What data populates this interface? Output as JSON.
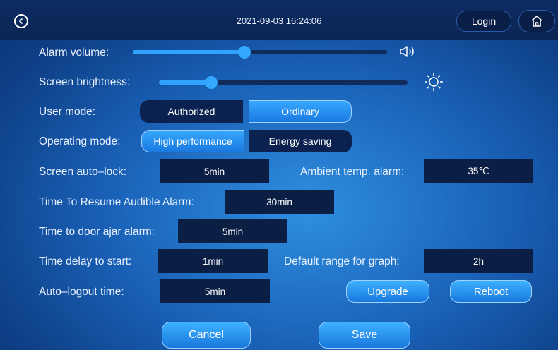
{
  "header": {
    "datetime": "2021-09-03 16:24:06",
    "login_label": "Login",
    "back_icon": "chevron-left-circle-icon",
    "home_icon": "home-icon"
  },
  "settings": {
    "alarm_volume": {
      "label": "Alarm volume:",
      "level": 0.44,
      "icon": "speaker-icon"
    },
    "screen_brightness": {
      "label": "Screen brightness:",
      "level": 0.21,
      "icon": "sun-icon"
    },
    "user_mode": {
      "label": "User mode:",
      "options": [
        "Authorized",
        "Ordinary"
      ],
      "selected": "Ordinary"
    },
    "operating_mode": {
      "label": "Operating mode:",
      "options": [
        "High performance",
        "Energy saving"
      ],
      "selected": "High performance"
    },
    "screen_auto_lock": {
      "label": "Screen auto–lock:",
      "value": "5min"
    },
    "ambient_temp_alarm": {
      "label": "Ambient temp. alarm:",
      "value": "35℃"
    },
    "resume_audible_alarm": {
      "label": "Time To Resume Audible Alarm:",
      "value": "30min"
    },
    "door_ajar_alarm": {
      "label": "Time to door ajar alarm:",
      "value": "5min"
    },
    "delay_to_start": {
      "label": "Time delay to start:",
      "value": "1min"
    },
    "default_graph_range": {
      "label": "Default range for graph:",
      "value": "2h"
    },
    "auto_logout": {
      "label": "Auto–logout time:",
      "value": "5min"
    }
  },
  "actions": {
    "upgrade": "Upgrade",
    "reboot": "Reboot",
    "cancel": "Cancel",
    "save": "Save"
  },
  "colors": {
    "accent": "#2fa3ff",
    "field_bg": "#0b1f44",
    "background": "#1a62b8"
  }
}
